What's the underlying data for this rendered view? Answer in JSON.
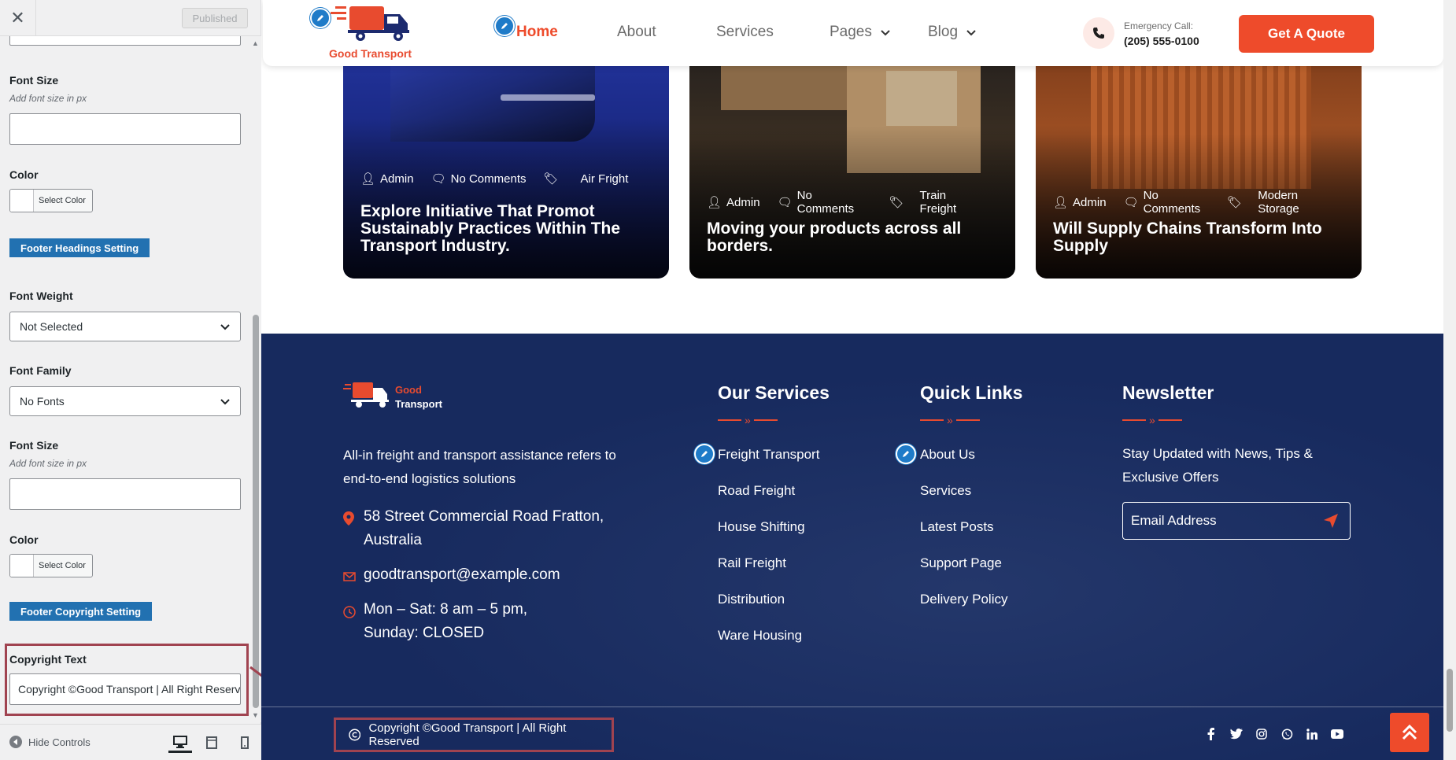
{
  "customizer": {
    "published_label": "Published",
    "fields": [
      {
        "label": "Font Size",
        "desc": "Add font size in px"
      },
      {
        "label": "Color",
        "color_button": "Select Color"
      },
      {
        "label": "Font Weight",
        "value": "Not Selected"
      },
      {
        "label": "Font Family",
        "value": "No Fonts"
      },
      {
        "label": "Font Size",
        "desc": "Add font size in px"
      },
      {
        "label": "Color",
        "color_button": "Select Color"
      },
      {
        "label": "Copyright Text",
        "value": "Copyright ©Good Transport | All Right Reserved"
      }
    ],
    "sections": [
      "Footer Headings Setting",
      "Footer Copyright Setting"
    ],
    "hide_controls_label": "Hide Controls",
    "devices": [
      "desktop-icon",
      "tablet-icon",
      "mobile-icon"
    ]
  },
  "site": {
    "brand": "Good Transport",
    "nav": [
      "Home",
      "About",
      "Services",
      "Pages",
      "Blog"
    ],
    "emergency_label": "Emergency Call:",
    "emergency_phone": "(205) 555-0100",
    "quote_button": "Get A Quote",
    "posts": [
      {
        "author": "Admin",
        "comments": "No Comments",
        "category": "Air Fright",
        "title": "Explore Initiative That Promot Sustainably Practices Within The Transport Industry."
      },
      {
        "author": "Admin",
        "comments": "No Comments",
        "category": "Train Freight",
        "title": "Moving your products across all borders."
      },
      {
        "author": "Admin",
        "comments": "No Comments",
        "category": "Modern Storage",
        "title": "Will Supply Chains Transform Into Supply"
      }
    ],
    "footer": {
      "logo_line1": "Good",
      "logo_line2": "Transport",
      "about_text": "All-in freight and transport assistance refers to end-to-end logistics solutions",
      "address": "58 Street Commercial Road Fratton, Australia",
      "email": "goodtransport@example.com",
      "hours": "Mon – Sat: 8 am – 5 pm, Sunday: CLOSED",
      "services_heading": "Our Services",
      "services": [
        "Freight Transport",
        "Road Freight",
        "House Shifting",
        "Rail Freight",
        "Distribution",
        "Ware Housing"
      ],
      "links_heading": "Quick Links",
      "links": [
        "About Us",
        "Services",
        "Latest Posts",
        "Support Page",
        "Delivery Policy"
      ],
      "newsletter_heading": "Newsletter",
      "newsletter_text": "Stay Updated with News, Tips & Exclusive Offers",
      "email_placeholder": "Email Address",
      "copyright": "Copyright ©Good Transport | All Right Reserved",
      "social": [
        "facebook-icon",
        "twitter-icon",
        "instagram-icon",
        "whatsapp-icon",
        "linkedin-icon",
        "youtube-icon"
      ]
    }
  },
  "colors": {
    "accent": "#ee4b2b",
    "footer_bg": "#172a5e",
    "wp_blue": "#2271b1",
    "highlight": "#a04350"
  }
}
